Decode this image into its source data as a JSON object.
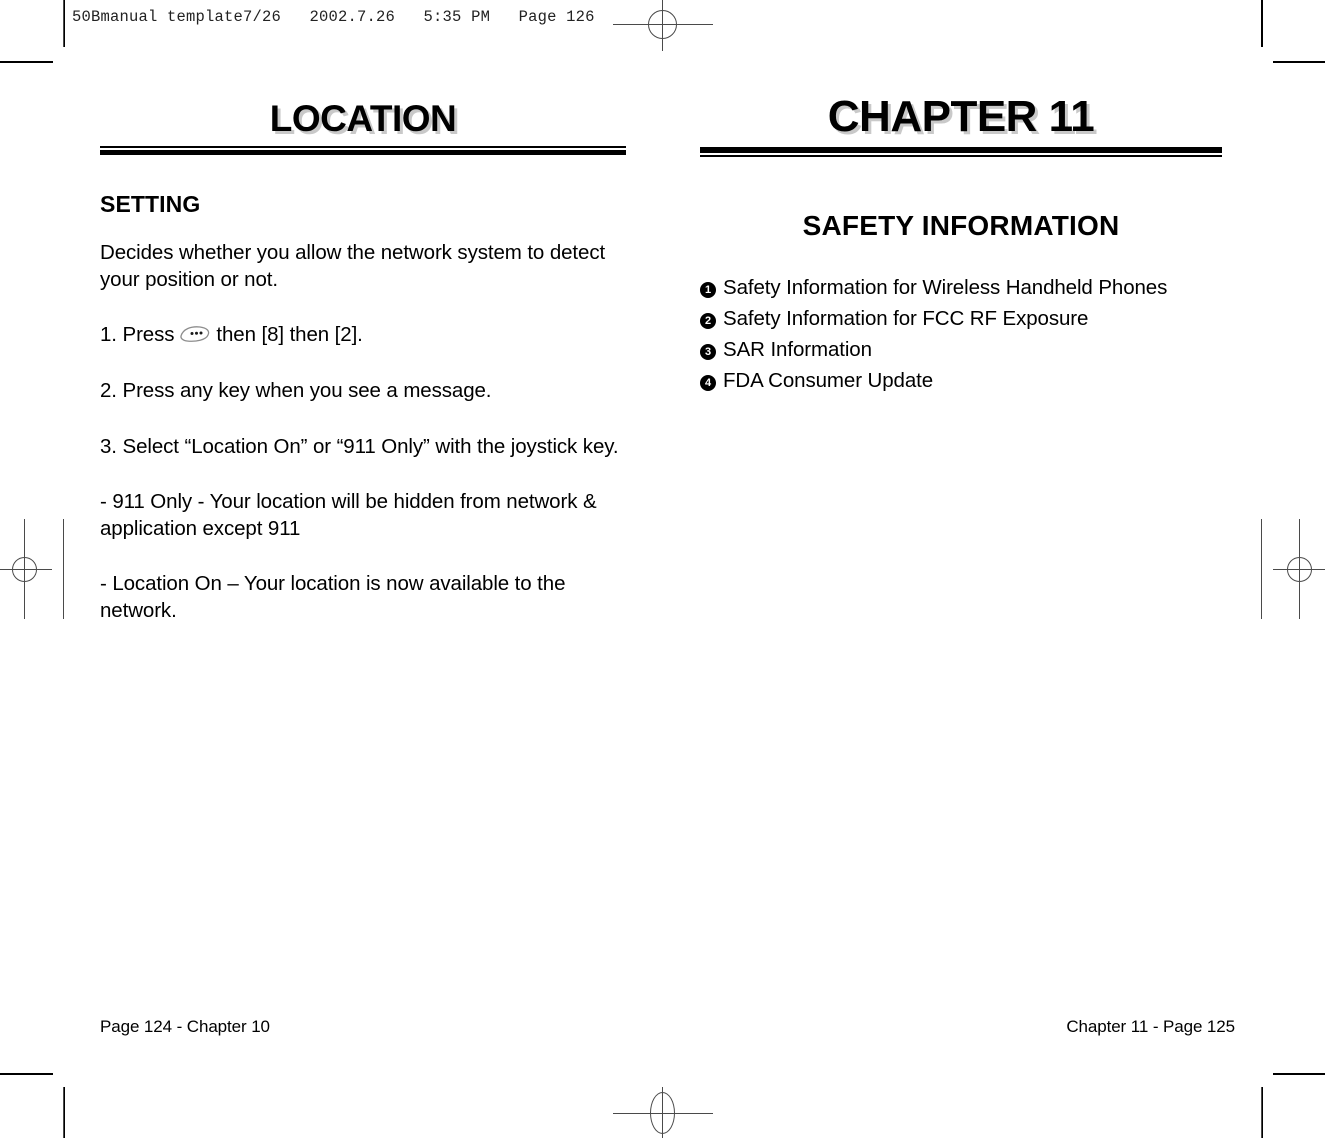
{
  "imprint": {
    "text": "50Bmanual template7/26   2002.7.26   5:35 PM   Page 126"
  },
  "left_page": {
    "banner_title": "LOCATION",
    "section_heading": "SETTING",
    "intro": "Decides whether you allow the network system to detect your position or not.",
    "steps": [
      {
        "before": "1. Press",
        "icon": "menu-key-icon",
        "after": "then [8] then [2]."
      },
      {
        "text": "2. Press any key when you see a message."
      },
      {
        "text": "3. Select “Location On” or “911 Only” with the joystick key."
      }
    ],
    "notes": [
      "- 911 Only - Your location will be hidden from network & application except 911",
      "- Location On – Your location is now available to the network."
    ],
    "footer": "Page 124 - Chapter 10"
  },
  "right_page": {
    "banner_title": "CHAPTER 11",
    "section_heading": "SAFETY INFORMATION",
    "toc": [
      {
        "num": "1",
        "glyph": "❶",
        "label": "Safety Information for Wireless Handheld Phones"
      },
      {
        "num": "2",
        "glyph": "❷",
        "label": "Safety Information for FCC RF Exposure"
      },
      {
        "num": "3",
        "glyph": "❸",
        "label": "SAR Information"
      },
      {
        "num": "4",
        "glyph": "❹",
        "label": "FDA Consumer Update"
      }
    ],
    "footer": "Chapter 11 - Page 125"
  },
  "colors": {
    "ink": "#000000",
    "title_shadow": "#c9c9c9",
    "mark_gray": "#4a4a4a",
    "paper": "#ffffff"
  },
  "print_marks": {
    "registration_mark_count": 4,
    "crop_mark_count": 8
  }
}
